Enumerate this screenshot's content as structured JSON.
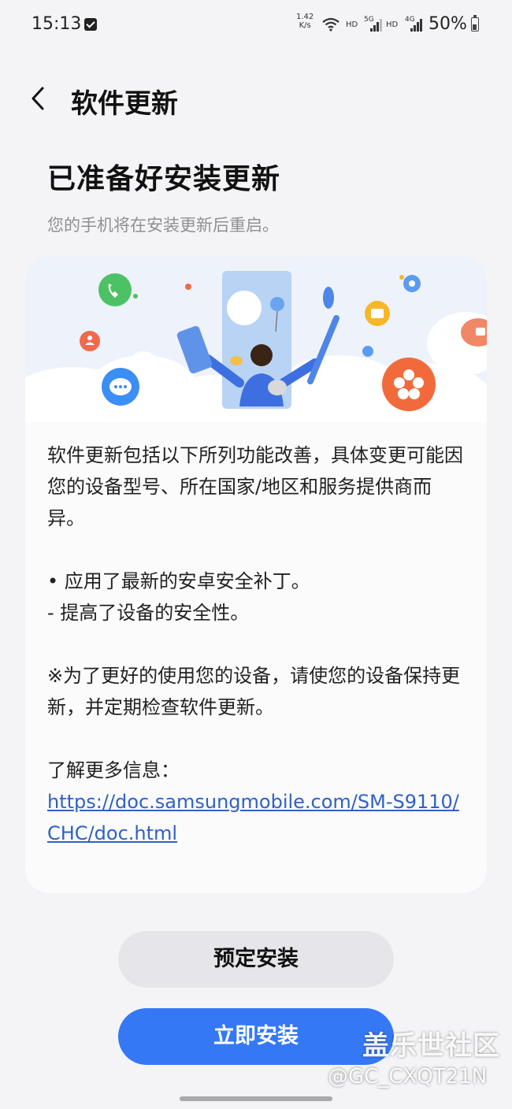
{
  "status_bar": {
    "time": "15:13",
    "speed_value": "1.42",
    "speed_unit": "K/s",
    "wifi_hd": "HD",
    "net_5g": "5G",
    "sim2_hd": "HD",
    "net_4g": "4G",
    "battery": "50%"
  },
  "header": {
    "title": "软件更新"
  },
  "main": {
    "heading": "已准备好安装更新",
    "subheading": "您的手机将在安装更新后重启。",
    "card": {
      "intro": "软件更新包括以下所列功能改善，具体变更可能因您的设备型号、所在国家/地区和服务提供商而异。",
      "bullet": "• 应用了最新的安卓安全补丁。",
      "sub_bullet": " - 提高了设备的安全性。",
      "note": "※为了更好的使用您的设备，请使您的设备保持更新，并定期检查软件更新。",
      "more_info_label": "了解更多信息：",
      "more_info_url": "https://doc.samsungmobile.com/SM-S9110/CHC/doc.html"
    }
  },
  "buttons": {
    "schedule": "预定安装",
    "install_now": "立即安装"
  },
  "watermark": {
    "brand": "盖乐世社区",
    "user": "@GC_CXQT21N"
  },
  "colors": {
    "accent": "#3478f6",
    "link": "#2f61c6",
    "background": "#f4f4f6",
    "card": "#fbfbfc"
  },
  "icons": [
    "check-icon",
    "wifi-icon",
    "signal-icon",
    "battery-icon",
    "back-chevron-icon",
    "phone-icon",
    "chat-icon",
    "flower-icon",
    "folder-icon",
    "settings-icon",
    "person-icon"
  ]
}
